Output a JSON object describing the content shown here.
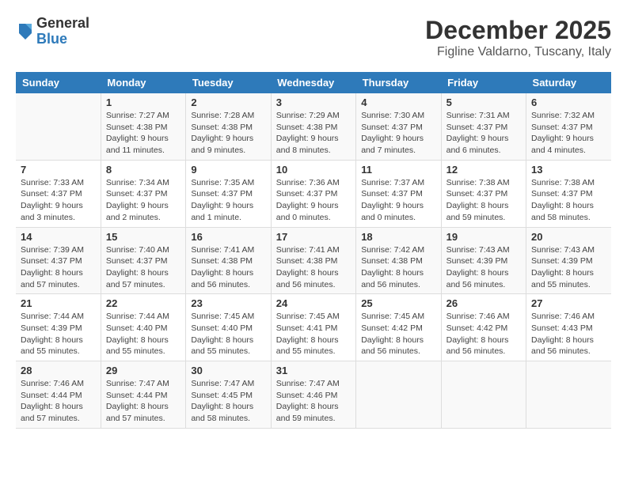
{
  "header": {
    "logo_general": "General",
    "logo_blue": "Blue",
    "month_title": "December 2025",
    "location": "Figline Valdarno, Tuscany, Italy"
  },
  "weekdays": [
    "Sunday",
    "Monday",
    "Tuesday",
    "Wednesday",
    "Thursday",
    "Friday",
    "Saturday"
  ],
  "weeks": [
    [
      {
        "day": "",
        "info": ""
      },
      {
        "day": "1",
        "info": "Sunrise: 7:27 AM\nSunset: 4:38 PM\nDaylight: 9 hours\nand 11 minutes."
      },
      {
        "day": "2",
        "info": "Sunrise: 7:28 AM\nSunset: 4:38 PM\nDaylight: 9 hours\nand 9 minutes."
      },
      {
        "day": "3",
        "info": "Sunrise: 7:29 AM\nSunset: 4:38 PM\nDaylight: 9 hours\nand 8 minutes."
      },
      {
        "day": "4",
        "info": "Sunrise: 7:30 AM\nSunset: 4:37 PM\nDaylight: 9 hours\nand 7 minutes."
      },
      {
        "day": "5",
        "info": "Sunrise: 7:31 AM\nSunset: 4:37 PM\nDaylight: 9 hours\nand 6 minutes."
      },
      {
        "day": "6",
        "info": "Sunrise: 7:32 AM\nSunset: 4:37 PM\nDaylight: 9 hours\nand 4 minutes."
      }
    ],
    [
      {
        "day": "7",
        "info": "Sunrise: 7:33 AM\nSunset: 4:37 PM\nDaylight: 9 hours\nand 3 minutes."
      },
      {
        "day": "8",
        "info": "Sunrise: 7:34 AM\nSunset: 4:37 PM\nDaylight: 9 hours\nand 2 minutes."
      },
      {
        "day": "9",
        "info": "Sunrise: 7:35 AM\nSunset: 4:37 PM\nDaylight: 9 hours\nand 1 minute."
      },
      {
        "day": "10",
        "info": "Sunrise: 7:36 AM\nSunset: 4:37 PM\nDaylight: 9 hours\nand 0 minutes."
      },
      {
        "day": "11",
        "info": "Sunrise: 7:37 AM\nSunset: 4:37 PM\nDaylight: 9 hours\nand 0 minutes."
      },
      {
        "day": "12",
        "info": "Sunrise: 7:38 AM\nSunset: 4:37 PM\nDaylight: 8 hours\nand 59 minutes."
      },
      {
        "day": "13",
        "info": "Sunrise: 7:38 AM\nSunset: 4:37 PM\nDaylight: 8 hours\nand 58 minutes."
      }
    ],
    [
      {
        "day": "14",
        "info": "Sunrise: 7:39 AM\nSunset: 4:37 PM\nDaylight: 8 hours\nand 57 minutes."
      },
      {
        "day": "15",
        "info": "Sunrise: 7:40 AM\nSunset: 4:37 PM\nDaylight: 8 hours\nand 57 minutes."
      },
      {
        "day": "16",
        "info": "Sunrise: 7:41 AM\nSunset: 4:38 PM\nDaylight: 8 hours\nand 56 minutes."
      },
      {
        "day": "17",
        "info": "Sunrise: 7:41 AM\nSunset: 4:38 PM\nDaylight: 8 hours\nand 56 minutes."
      },
      {
        "day": "18",
        "info": "Sunrise: 7:42 AM\nSunset: 4:38 PM\nDaylight: 8 hours\nand 56 minutes."
      },
      {
        "day": "19",
        "info": "Sunrise: 7:43 AM\nSunset: 4:39 PM\nDaylight: 8 hours\nand 56 minutes."
      },
      {
        "day": "20",
        "info": "Sunrise: 7:43 AM\nSunset: 4:39 PM\nDaylight: 8 hours\nand 55 minutes."
      }
    ],
    [
      {
        "day": "21",
        "info": "Sunrise: 7:44 AM\nSunset: 4:39 PM\nDaylight: 8 hours\nand 55 minutes."
      },
      {
        "day": "22",
        "info": "Sunrise: 7:44 AM\nSunset: 4:40 PM\nDaylight: 8 hours\nand 55 minutes."
      },
      {
        "day": "23",
        "info": "Sunrise: 7:45 AM\nSunset: 4:40 PM\nDaylight: 8 hours\nand 55 minutes."
      },
      {
        "day": "24",
        "info": "Sunrise: 7:45 AM\nSunset: 4:41 PM\nDaylight: 8 hours\nand 55 minutes."
      },
      {
        "day": "25",
        "info": "Sunrise: 7:45 AM\nSunset: 4:42 PM\nDaylight: 8 hours\nand 56 minutes."
      },
      {
        "day": "26",
        "info": "Sunrise: 7:46 AM\nSunset: 4:42 PM\nDaylight: 8 hours\nand 56 minutes."
      },
      {
        "day": "27",
        "info": "Sunrise: 7:46 AM\nSunset: 4:43 PM\nDaylight: 8 hours\nand 56 minutes."
      }
    ],
    [
      {
        "day": "28",
        "info": "Sunrise: 7:46 AM\nSunset: 4:44 PM\nDaylight: 8 hours\nand 57 minutes."
      },
      {
        "day": "29",
        "info": "Sunrise: 7:47 AM\nSunset: 4:44 PM\nDaylight: 8 hours\nand 57 minutes."
      },
      {
        "day": "30",
        "info": "Sunrise: 7:47 AM\nSunset: 4:45 PM\nDaylight: 8 hours\nand 58 minutes."
      },
      {
        "day": "31",
        "info": "Sunrise: 7:47 AM\nSunset: 4:46 PM\nDaylight: 8 hours\nand 59 minutes."
      },
      {
        "day": "",
        "info": ""
      },
      {
        "day": "",
        "info": ""
      },
      {
        "day": "",
        "info": ""
      }
    ]
  ]
}
